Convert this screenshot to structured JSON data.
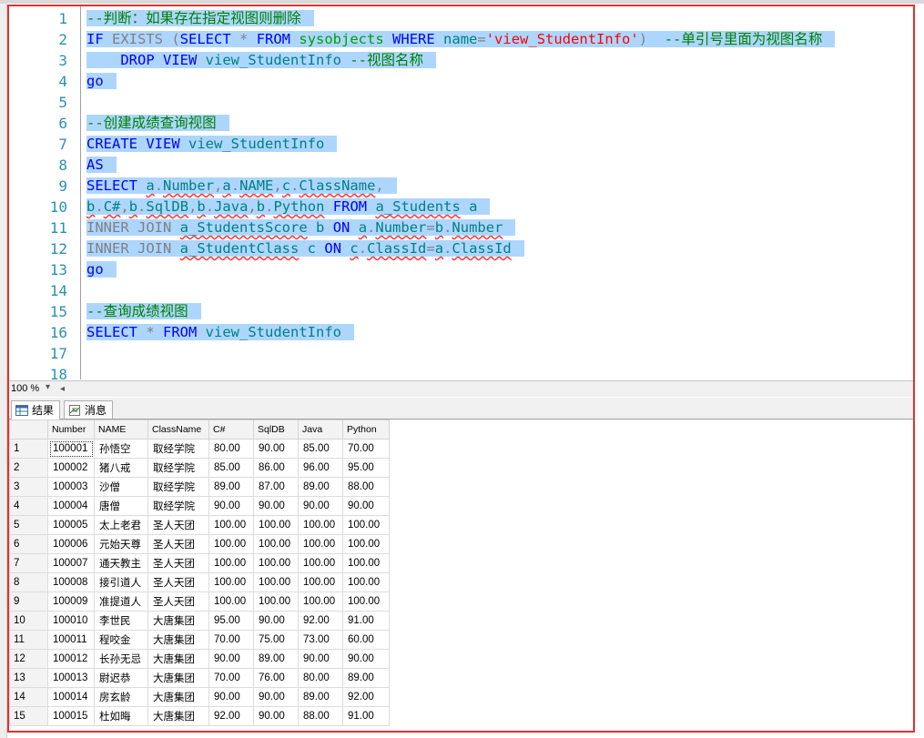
{
  "editor": {
    "line_numbers": [
      "1",
      "2",
      "3",
      "4",
      "5",
      "6",
      "7",
      "8",
      "9",
      "10",
      "11",
      "12",
      "13",
      "14",
      "15",
      "16",
      "17",
      "18"
    ],
    "lines": [
      [
        {
          "t": "--判断：如果存在指定视图则删除",
          "c": "cm"
        }
      ],
      [
        {
          "t": "IF",
          "c": "kw"
        },
        {
          "t": " "
        },
        {
          "t": "EXISTS",
          "c": "gr"
        },
        {
          "t": " (",
          "c": "gr"
        },
        {
          "t": "SELECT",
          "c": "kw"
        },
        {
          "t": " * ",
          "c": "gr"
        },
        {
          "t": "FROM",
          "c": "kw"
        },
        {
          "t": " "
        },
        {
          "t": "sysobjects",
          "c": "sys"
        },
        {
          "t": " "
        },
        {
          "t": "WHERE",
          "c": "kw"
        },
        {
          "t": " "
        },
        {
          "t": "name",
          "c": "id"
        },
        {
          "t": "=",
          "c": "gr"
        },
        {
          "t": "'view_StudentInfo'",
          "c": "st"
        },
        {
          "t": ")",
          "c": "gr"
        },
        {
          "t": "  "
        },
        {
          "t": "--单引号里面为视图名称",
          "c": "cm"
        }
      ],
      [
        {
          "t": "    "
        },
        {
          "t": "DROP",
          "c": "kw"
        },
        {
          "t": " "
        },
        {
          "t": "VIEW",
          "c": "kw"
        },
        {
          "t": " "
        },
        {
          "t": "view_StudentInfo",
          "c": "id"
        },
        {
          "t": " "
        },
        {
          "t": "--视图名称",
          "c": "cm"
        }
      ],
      [
        {
          "t": "go",
          "c": "kw"
        }
      ],
      [],
      [
        {
          "t": "--创建成绩查询视图",
          "c": "cm"
        }
      ],
      [
        {
          "t": "CREATE",
          "c": "kw"
        },
        {
          "t": " "
        },
        {
          "t": "VIEW",
          "c": "kw"
        },
        {
          "t": " "
        },
        {
          "t": "view_StudentInfo",
          "c": "id"
        }
      ],
      [
        {
          "t": "AS",
          "c": "kw"
        }
      ],
      [
        {
          "t": "SELECT",
          "c": "kw"
        },
        {
          "t": " "
        },
        {
          "t": "a",
          "c": "id sq"
        },
        {
          "t": ".",
          "c": "gr"
        },
        {
          "t": "Number",
          "c": "id sq"
        },
        {
          "t": ",",
          "c": "gr"
        },
        {
          "t": "a",
          "c": "id sq"
        },
        {
          "t": ".",
          "c": "gr"
        },
        {
          "t": "NAME",
          "c": "id sq"
        },
        {
          "t": ",",
          "c": "gr"
        },
        {
          "t": "c",
          "c": "id sq"
        },
        {
          "t": ".",
          "c": "gr"
        },
        {
          "t": "ClassName",
          "c": "id sq"
        },
        {
          "t": ",",
          "c": "gr"
        }
      ],
      [
        {
          "t": "b",
          "c": "id sq"
        },
        {
          "t": ".",
          "c": "gr"
        },
        {
          "t": "C#",
          "c": "id sq"
        },
        {
          "t": ",",
          "c": "gr"
        },
        {
          "t": "b",
          "c": "id sq"
        },
        {
          "t": ".",
          "c": "gr"
        },
        {
          "t": "SqlDB",
          "c": "id sq"
        },
        {
          "t": ",",
          "c": "gr"
        },
        {
          "t": "b",
          "c": "id sq"
        },
        {
          "t": ".",
          "c": "gr"
        },
        {
          "t": "Java",
          "c": "id sq"
        },
        {
          "t": ",",
          "c": "gr"
        },
        {
          "t": "b",
          "c": "id sq"
        },
        {
          "t": ".",
          "c": "gr"
        },
        {
          "t": "Python",
          "c": "id sq"
        },
        {
          "t": " "
        },
        {
          "t": "FROM",
          "c": "kw"
        },
        {
          "t": " "
        },
        {
          "t": "a_Students",
          "c": "id sq"
        },
        {
          "t": " "
        },
        {
          "t": "a",
          "c": "id"
        }
      ],
      [
        {
          "t": "INNER JOIN",
          "c": "gr"
        },
        {
          "t": " "
        },
        {
          "t": "a_StudentsScore",
          "c": "id sq"
        },
        {
          "t": " "
        },
        {
          "t": "b",
          "c": "id"
        },
        {
          "t": " "
        },
        {
          "t": "ON",
          "c": "kw"
        },
        {
          "t": " "
        },
        {
          "t": "a",
          "c": "id sq"
        },
        {
          "t": ".",
          "c": "gr"
        },
        {
          "t": "Number",
          "c": "id sq"
        },
        {
          "t": "=",
          "c": "gr"
        },
        {
          "t": "b",
          "c": "id sq"
        },
        {
          "t": ".",
          "c": "gr"
        },
        {
          "t": "Number",
          "c": "id sq"
        }
      ],
      [
        {
          "t": "INNER JOIN",
          "c": "gr"
        },
        {
          "t": " "
        },
        {
          "t": "a_StudentClass",
          "c": "id sq"
        },
        {
          "t": " "
        },
        {
          "t": "c",
          "c": "id"
        },
        {
          "t": " "
        },
        {
          "t": "ON",
          "c": "kw"
        },
        {
          "t": " "
        },
        {
          "t": "c",
          "c": "id sq"
        },
        {
          "t": ".",
          "c": "gr"
        },
        {
          "t": "ClassId",
          "c": "id sq"
        },
        {
          "t": "=",
          "c": "gr"
        },
        {
          "t": "a",
          "c": "id sq"
        },
        {
          "t": ".",
          "c": "gr"
        },
        {
          "t": "ClassId",
          "c": "id sq"
        }
      ],
      [
        {
          "t": "go",
          "c": "kw"
        }
      ],
      [],
      [
        {
          "t": "--查询成绩视图",
          "c": "cm"
        }
      ],
      [
        {
          "t": "SELECT",
          "c": "kw"
        },
        {
          "t": " * ",
          "c": "gr"
        },
        {
          "t": "FROM",
          "c": "kw"
        },
        {
          "t": " "
        },
        {
          "t": "view_StudentInfo",
          "c": "id"
        }
      ],
      [],
      []
    ]
  },
  "zoom": {
    "value": "100 %"
  },
  "tabs": [
    {
      "label": "结果",
      "icon": "grid-icon"
    },
    {
      "label": "消息",
      "icon": "message-icon"
    }
  ],
  "results": {
    "columns": [
      "Number",
      "NAME",
      "ClassName",
      "C#",
      "SqlDB",
      "Java",
      "Python"
    ],
    "rows": [
      [
        "1",
        "100001",
        "孙悟空",
        "取经学院",
        "80.00",
        "90.00",
        "85.00",
        "70.00"
      ],
      [
        "2",
        "100002",
        "猪八戒",
        "取经学院",
        "85.00",
        "86.00",
        "96.00",
        "95.00"
      ],
      [
        "3",
        "100003",
        "沙僧",
        "取经学院",
        "89.00",
        "87.00",
        "89.00",
        "88.00"
      ],
      [
        "4",
        "100004",
        "唐僧",
        "取经学院",
        "90.00",
        "90.00",
        "90.00",
        "90.00"
      ],
      [
        "5",
        "100005",
        "太上老君",
        "圣人天团",
        "100.00",
        "100.00",
        "100.00",
        "100.00"
      ],
      [
        "6",
        "100006",
        "元始天尊",
        "圣人天团",
        "100.00",
        "100.00",
        "100.00",
        "100.00"
      ],
      [
        "7",
        "100007",
        "通天教主",
        "圣人天团",
        "100.00",
        "100.00",
        "100.00",
        "100.00"
      ],
      [
        "8",
        "100008",
        "接引道人",
        "圣人天团",
        "100.00",
        "100.00",
        "100.00",
        "100.00"
      ],
      [
        "9",
        "100009",
        "准提道人",
        "圣人天团",
        "100.00",
        "100.00",
        "100.00",
        "100.00"
      ],
      [
        "10",
        "100010",
        "李世民",
        "大唐集团",
        "95.00",
        "90.00",
        "92.00",
        "91.00"
      ],
      [
        "11",
        "100011",
        "程咬金",
        "大唐集团",
        "70.00",
        "75.00",
        "73.00",
        "60.00"
      ],
      [
        "12",
        "100012",
        "长孙无忌",
        "大唐集团",
        "90.00",
        "89.00",
        "90.00",
        "90.00"
      ],
      [
        "13",
        "100013",
        "尉迟恭",
        "大唐集团",
        "70.00",
        "76.00",
        "80.00",
        "89.00"
      ],
      [
        "14",
        "100014",
        "房玄龄",
        "大唐集团",
        "90.00",
        "90.00",
        "89.00",
        "92.00"
      ],
      [
        "15",
        "100015",
        "杜如晦",
        "大唐集团",
        "92.00",
        "90.00",
        "88.00",
        "91.00"
      ]
    ]
  },
  "colors": {
    "selection": "#add6ff",
    "keyword": "#0000ff",
    "comment": "#008000",
    "string": "#ff0000",
    "frame": "#e0322f"
  }
}
